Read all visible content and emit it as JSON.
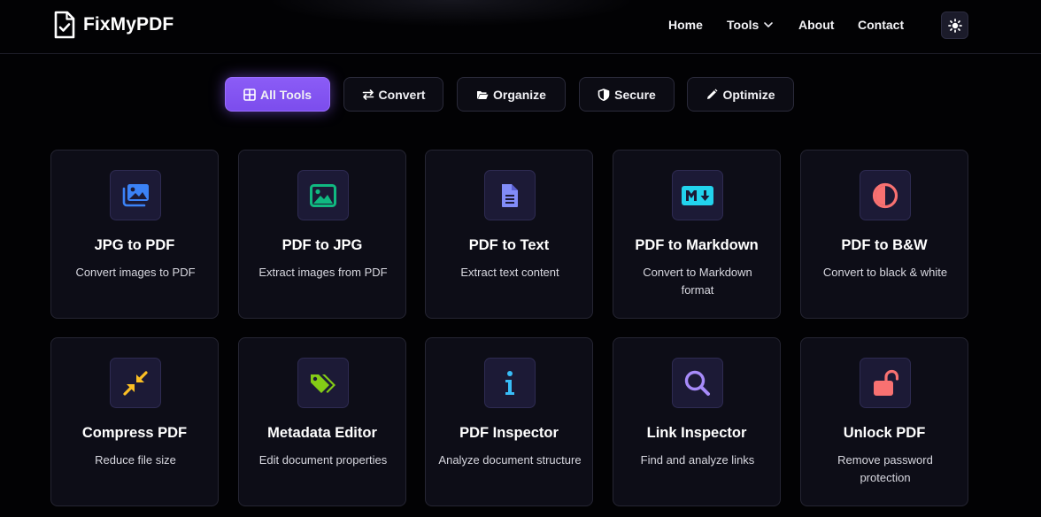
{
  "brand": {
    "name": "FixMyPDF"
  },
  "nav": {
    "home": "Home",
    "tools": "Tools",
    "about": "About",
    "contact": "Contact"
  },
  "filters": [
    {
      "label": "All Tools",
      "icon": "grid-icon",
      "active": true
    },
    {
      "label": "Convert",
      "icon": "swap-arrows-icon",
      "active": false
    },
    {
      "label": "Organize",
      "icon": "folder-open-icon",
      "active": false
    },
    {
      "label": "Secure",
      "icon": "shield-icon",
      "active": false
    },
    {
      "label": "Optimize",
      "icon": "pencil-icon",
      "active": false
    }
  ],
  "tools": [
    {
      "title": "JPG to PDF",
      "desc": "Convert images to PDF",
      "icon": "images-icon",
      "color": "#3b82f6"
    },
    {
      "title": "PDF to JPG",
      "desc": "Extract images from PDF",
      "icon": "image-icon",
      "color": "#10b981"
    },
    {
      "title": "PDF to Text",
      "desc": "Extract text content",
      "icon": "document-text-icon",
      "color": "#818cf8"
    },
    {
      "title": "PDF to Markdown",
      "desc": "Convert to Markdown format",
      "icon": "markdown-icon",
      "color": "#22d3ee"
    },
    {
      "title": "PDF to B&W",
      "desc": "Convert to black & white",
      "icon": "contrast-icon",
      "color": "#f87171"
    },
    {
      "title": "Compress PDF",
      "desc": "Reduce file size",
      "icon": "compress-arrows-icon",
      "color": "#fbbf24"
    },
    {
      "title": "Metadata Editor",
      "desc": "Edit document properties",
      "icon": "tags-icon",
      "color": "#84cc16"
    },
    {
      "title": "PDF Inspector",
      "desc": "Analyze document structure",
      "icon": "info-icon",
      "color": "#38bdf8"
    },
    {
      "title": "Link Inspector",
      "desc": "Find and analyze links",
      "icon": "magnifier-icon",
      "color": "#a78bfa"
    },
    {
      "title": "Unlock PDF",
      "desc": "Remove password protection",
      "icon": "unlock-icon",
      "color": "#f87171"
    }
  ]
}
